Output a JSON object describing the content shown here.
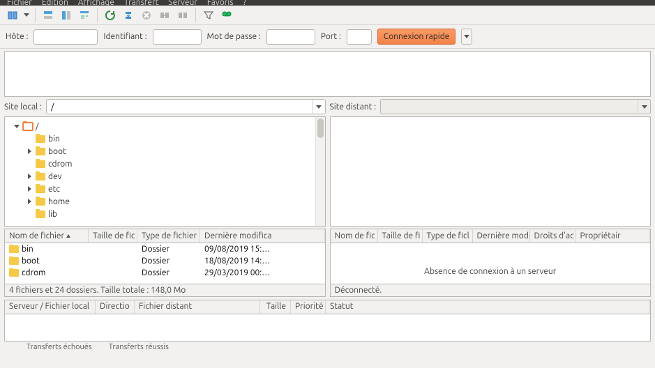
{
  "menu": {
    "items": [
      "Fichier",
      "Édition",
      "Affichage",
      "Transfert",
      "Serveur",
      "Favoris",
      "?"
    ]
  },
  "toolbar": {
    "icons": [
      "site-manager",
      "dropdown",
      "sep",
      "toggle-log",
      "toggle-tree",
      "toggle-queue",
      "sep",
      "refresh",
      "process-queue",
      "cancel",
      "disconnect",
      "reconnect",
      "sep",
      "filter",
      "search"
    ]
  },
  "quickconnect": {
    "host_label": "Hôte :",
    "user_label": "Identifiant :",
    "pass_label": "Mot de passe :",
    "port_label": "Port :",
    "btn": "Connexion rapide",
    "host": "",
    "user": "",
    "pass": "",
    "port": ""
  },
  "local": {
    "label": "Site local :",
    "path": "/",
    "tree": [
      {
        "name": "/",
        "sel": true,
        "exp": "open",
        "depth": 0
      },
      {
        "name": "bin",
        "depth": 1
      },
      {
        "name": "boot",
        "exp": "closed",
        "depth": 1
      },
      {
        "name": "cdrom",
        "depth": 1
      },
      {
        "name": "dev",
        "exp": "closed",
        "depth": 1
      },
      {
        "name": "etc",
        "exp": "closed",
        "depth": 1
      },
      {
        "name": "home",
        "exp": "closed",
        "depth": 1
      },
      {
        "name": "lib",
        "depth": 1
      }
    ],
    "cols": [
      "Nom de fichier",
      "Taille de fic",
      "Type de fichier",
      "Dernière modifica"
    ],
    "rows": [
      {
        "name": "bin",
        "type": "Dossier",
        "date": "09/08/2019 15:…"
      },
      {
        "name": "boot",
        "type": "Dossier",
        "date": "18/08/2019 14:…"
      },
      {
        "name": "cdrom",
        "type": "Dossier",
        "date": "29/03/2019 00:…"
      }
    ],
    "footer": "4 fichiers et 24 dossiers. Taille totale : 148,0 Mo"
  },
  "remote": {
    "label": "Site distant :",
    "path": "",
    "cols": [
      "Nom de fic",
      "Taille de fi",
      "Type de ficl",
      "Dernière modi",
      "Droits d'ac",
      "Propriétair"
    ],
    "empty": "Absence de connexion à un serveur",
    "footer": "Déconnecté."
  },
  "queue": {
    "cols": [
      "Serveur / Fichier local",
      "Directio",
      "Fichier distant",
      "Taille",
      "Priorité",
      "Statut"
    ],
    "tabs": [
      "",
      "Transferts échoués",
      "Transferts réussis"
    ]
  }
}
